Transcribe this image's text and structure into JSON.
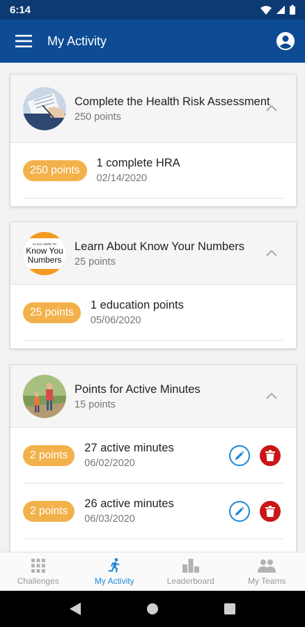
{
  "status_bar": {
    "time": "6:14"
  },
  "app_bar": {
    "title": "My Activity",
    "menu_icon": "hamburger-menu-icon",
    "profile_icon": "account-circle-icon"
  },
  "colors": {
    "status_bar": "#0d3a73",
    "app_bar": "#0d4c95",
    "pill": "#f2b14a",
    "accent": "#1e88d8",
    "delete": "#c91616"
  },
  "activities": [
    {
      "title": "Complete the Health Risk Assessment",
      "points": "250 points",
      "entries": [
        {
          "points": "250 points",
          "title": "1 complete HRA",
          "date": "02/14/2020"
        }
      ]
    },
    {
      "title": "Learn About Know Your Numbers",
      "points": "25 points",
      "thumb_text_small": "CLICK HERE TO",
      "thumb_text_line1": "Know You",
      "thumb_text_line2": "Numbers",
      "entries": [
        {
          "points": "25 points",
          "title": "1 education points",
          "date": "05/06/2020"
        }
      ]
    },
    {
      "title": "Points for Active Minutes",
      "points": "15 points",
      "entries": [
        {
          "points": "2 points",
          "title": "27 active minutes",
          "date": "06/02/2020"
        },
        {
          "points": "2 points",
          "title": "26 active minutes",
          "date": "06/03/2020"
        }
      ]
    }
  ],
  "bottom_nav": [
    {
      "label": "Challenges",
      "icon": "grid-icon",
      "active": false
    },
    {
      "label": "My Activity",
      "icon": "running-person-icon",
      "active": true
    },
    {
      "label": "Leaderboard",
      "icon": "bar-chart-icon",
      "active": false
    },
    {
      "label": "My Teams",
      "icon": "people-icon",
      "active": false
    }
  ]
}
